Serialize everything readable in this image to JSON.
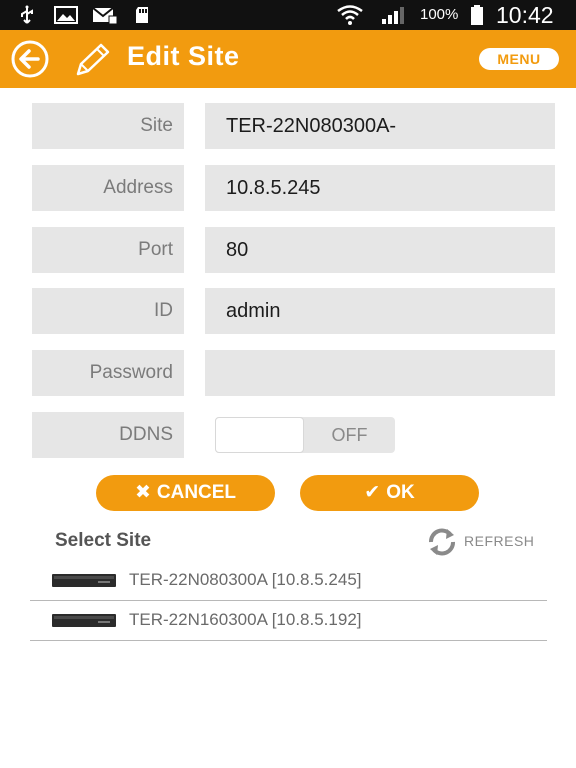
{
  "status_bar": {
    "battery_percent": "100%",
    "time": "10:42",
    "icons": [
      "usb-icon",
      "image-icon",
      "mail-icon",
      "sd-card-icon",
      "wifi-icon",
      "signal-icon",
      "battery-icon"
    ]
  },
  "app_bar": {
    "title": "Edit Site",
    "menu_label": "MENU",
    "back_icon": "back-arrow-icon",
    "title_icon": "pencil-icon",
    "accent_color": "#f29b0f"
  },
  "form": {
    "site": {
      "label": "Site",
      "value": "TER-22N080300A-"
    },
    "address": {
      "label": "Address",
      "value": "10.8.5.245"
    },
    "port": {
      "label": "Port",
      "value": "80"
    },
    "id": {
      "label": "ID",
      "value": "admin"
    },
    "password": {
      "label": "Password",
      "value": ""
    },
    "ddns": {
      "label": "DDNS",
      "state": "OFF"
    }
  },
  "actions": {
    "cancel_label": "CANCEL",
    "ok_label": "OK"
  },
  "select_site": {
    "title": "Select Site",
    "refresh_label": "REFRESH",
    "sites": [
      {
        "label": "TER-22N080300A [10.8.5.245]"
      },
      {
        "label": "TER-22N160300A [10.8.5.192]"
      }
    ]
  }
}
